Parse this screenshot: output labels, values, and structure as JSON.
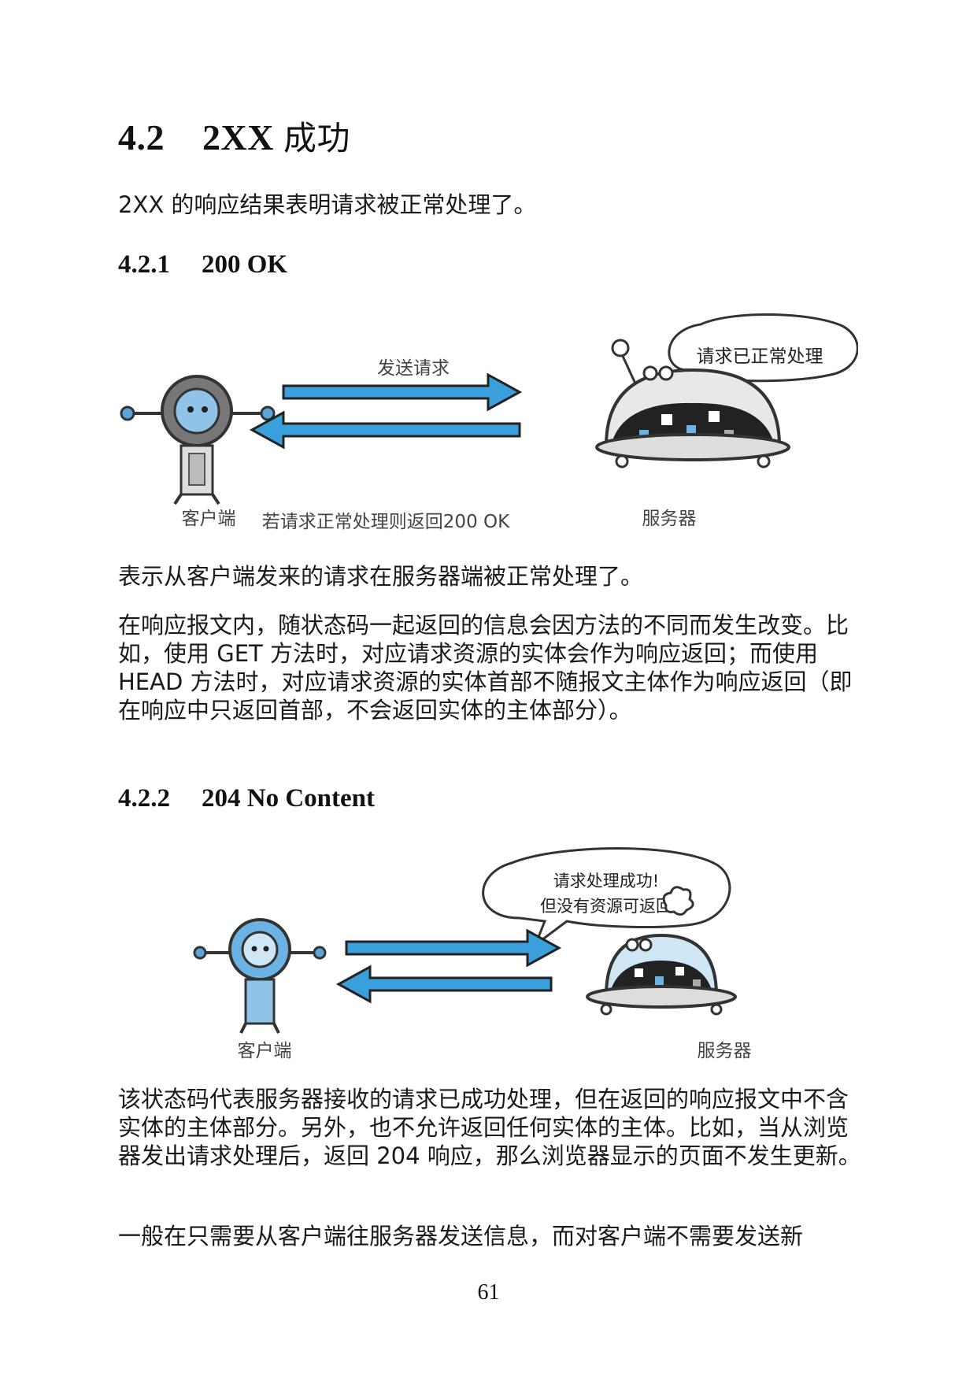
{
  "section": {
    "number": "4.2",
    "title_en": "2XX",
    "title_cn": "成功"
  },
  "intro": "2XX 的响应结果表明请求被正常处理了。",
  "sub1": {
    "number": "4.2.1",
    "title": "200 OK"
  },
  "fig1": {
    "bubble": "请求已正常处理",
    "send_label": "发送请求",
    "client_label": "客户端",
    "server_label": "服务器",
    "return_label": "若请求正常处理则返回200 OK"
  },
  "p1": "表示从客户端发来的请求在服务器端被正常处理了。",
  "p2": "在响应报文内，随状态码一起返回的信息会因方法的不同而发生改变。比如，使用 GET 方法时，对应请求资源的实体会作为响应返回；而使用 HEAD 方法时，对应请求资源的实体首部不随报文主体作为响应返回（即在响应中只返回首部，不会返回实体的主体部分）。",
  "sub2": {
    "number": "4.2.2",
    "title": "204 No Content"
  },
  "fig2": {
    "bubble_line1": "请求处理成功!",
    "bubble_line2": "但没有资源可返回",
    "client_label": "客户端",
    "server_label": "服务器"
  },
  "p3": "该状态码代表服务器接收的请求已成功处理，但在返回的响应报文中不含实体的主体部分。另外，也不允许返回任何实体的主体。比如，当从浏览器发出请求处理后，返回 204 响应，那么浏览器显示的页面不发生更新。",
  "p4": "一般在只需要从客户端往服务器发送信息，而对客户端不需要发送新",
  "page_number": "61"
}
